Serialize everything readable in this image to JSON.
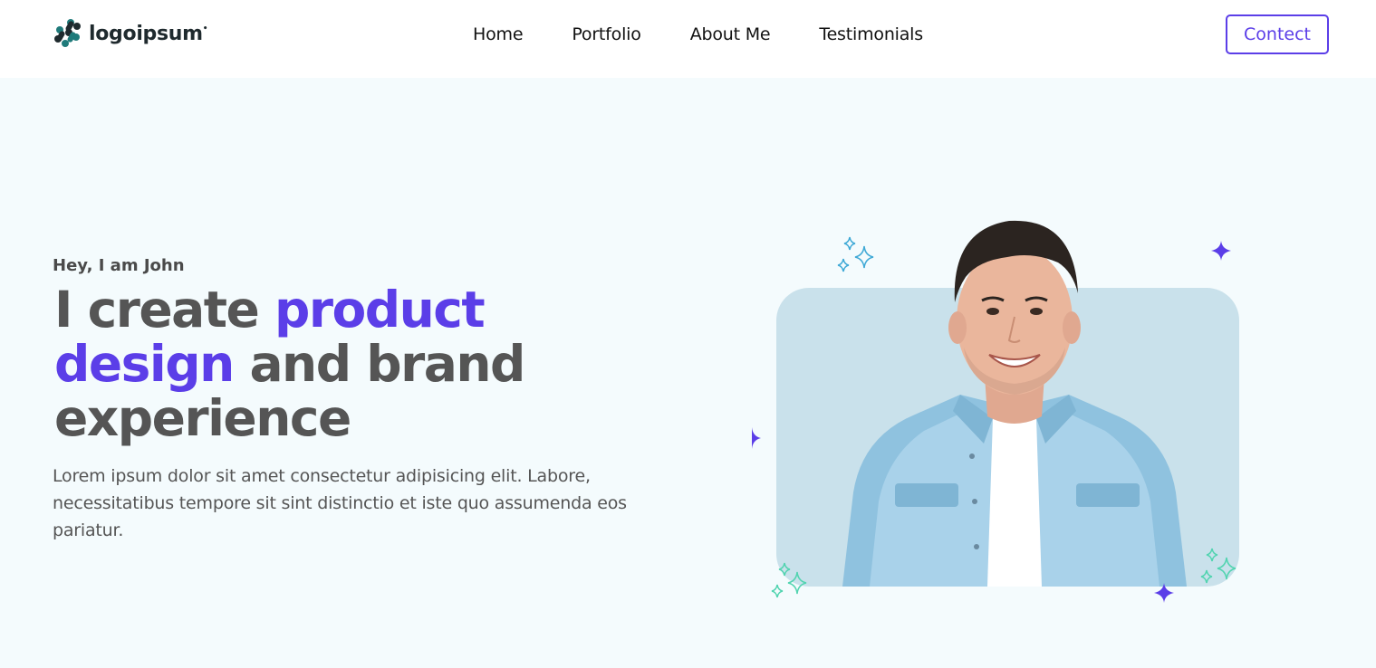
{
  "header": {
    "logo_text": "logoipsum",
    "nav": [
      "Home",
      "Portfolio",
      "About Me",
      "Testimonials"
    ],
    "contact_label": "Contect"
  },
  "hero": {
    "greeting": "Hey, I am John",
    "headline_part1": "I create ",
    "headline_accent1": "product",
    "headline_accent2": "design",
    "headline_part2": " and brand experience",
    "description": "Lorem ipsum dolor sit amet consectetur adipisicing elit. Labore, necessitatibus tempore sit sint distinctio et iste quo assumenda eos pariatur."
  },
  "colors": {
    "accent": "#5b3ee8",
    "hero_bg": "#f4fbfd",
    "card_bg": "#c9e1eb",
    "sparkle_blue": "#3fa9d6",
    "sparkle_teal": "#52d4b0"
  }
}
